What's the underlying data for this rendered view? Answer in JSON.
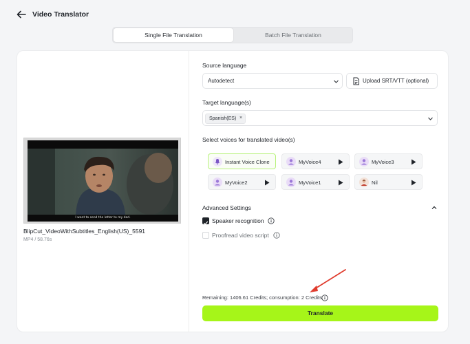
{
  "header": {
    "title": "Video Translator"
  },
  "tabs": [
    {
      "label": "Single File Translation",
      "active": true
    },
    {
      "label": "Batch File Translation",
      "active": false
    }
  ],
  "video": {
    "subtitle": "I want to send the letter to my dad.",
    "file_name": "BlipCut_VideoWithSubtitles_English(US)_5591",
    "file_meta": "MP4 / 58.76s"
  },
  "source_language": {
    "label": "Source language",
    "value": "Autodetect"
  },
  "upload": {
    "label": "Upload SRT/VTT (optional)"
  },
  "target_language": {
    "label": "Target language(s)",
    "tags": [
      "Spanish(ES)"
    ],
    "remove_glyph": "×"
  },
  "voices": {
    "label": "Select voices for translated video(s)",
    "items": [
      {
        "name": "Instant Voice Clone",
        "selected": true,
        "icon": "mic-icon"
      },
      {
        "name": "MyVoice4",
        "selected": false,
        "icon": "voice-avatar-icon"
      },
      {
        "name": "MyVoice3",
        "selected": false,
        "icon": "voice-avatar-icon"
      },
      {
        "name": "MyVoice2",
        "selected": false,
        "icon": "voice-avatar-icon"
      },
      {
        "name": "MyVoice1",
        "selected": false,
        "icon": "voice-avatar-icon"
      },
      {
        "name": "Nil",
        "selected": false,
        "icon": "person-avatar-icon"
      }
    ]
  },
  "advanced": {
    "title": "Advanced Settings",
    "options": [
      {
        "label": "Speaker recognition",
        "checked": true
      },
      {
        "label": "Proofread video script",
        "checked": false
      }
    ]
  },
  "footer": {
    "credits": "Remaining: 1406.61 Credits; consumption: 2 Credits",
    "translate_label": "Translate"
  },
  "colors": {
    "accent": "#a6f519",
    "selected_border": "#b7f27a",
    "annotation": "#e03c2e"
  }
}
